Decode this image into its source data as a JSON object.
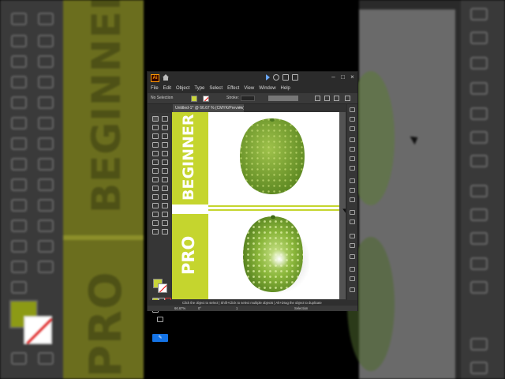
{
  "background": {
    "word_top": "BEGINNER",
    "word_bottom": "PRO"
  },
  "window": {
    "logo": "Ai",
    "controls": [
      "–",
      "□",
      "×"
    ]
  },
  "menu": [
    "File",
    "Edit",
    "Object",
    "Type",
    "Select",
    "Effect",
    "View",
    "Window",
    "Help"
  ],
  "control_bar": {
    "selection_text": "No Selection",
    "stroke_label": "Stroke:",
    "fill_color": "#c8d53a"
  },
  "document_tab": "Untitled-1* @ 66.67 % (CMYK/Preview)",
  "artboard": {
    "word_top": "BEGINNER",
    "word_bottom": "PRO",
    "band_color": "#c5d52e"
  },
  "status": {
    "hint": "Click the object to select  |  Shift+Click to select multiple objects  |  Alt+Drag the object to duplicate",
    "zoom": "66.67%",
    "angle": "0°",
    "page": "1",
    "tool": "Selection"
  }
}
